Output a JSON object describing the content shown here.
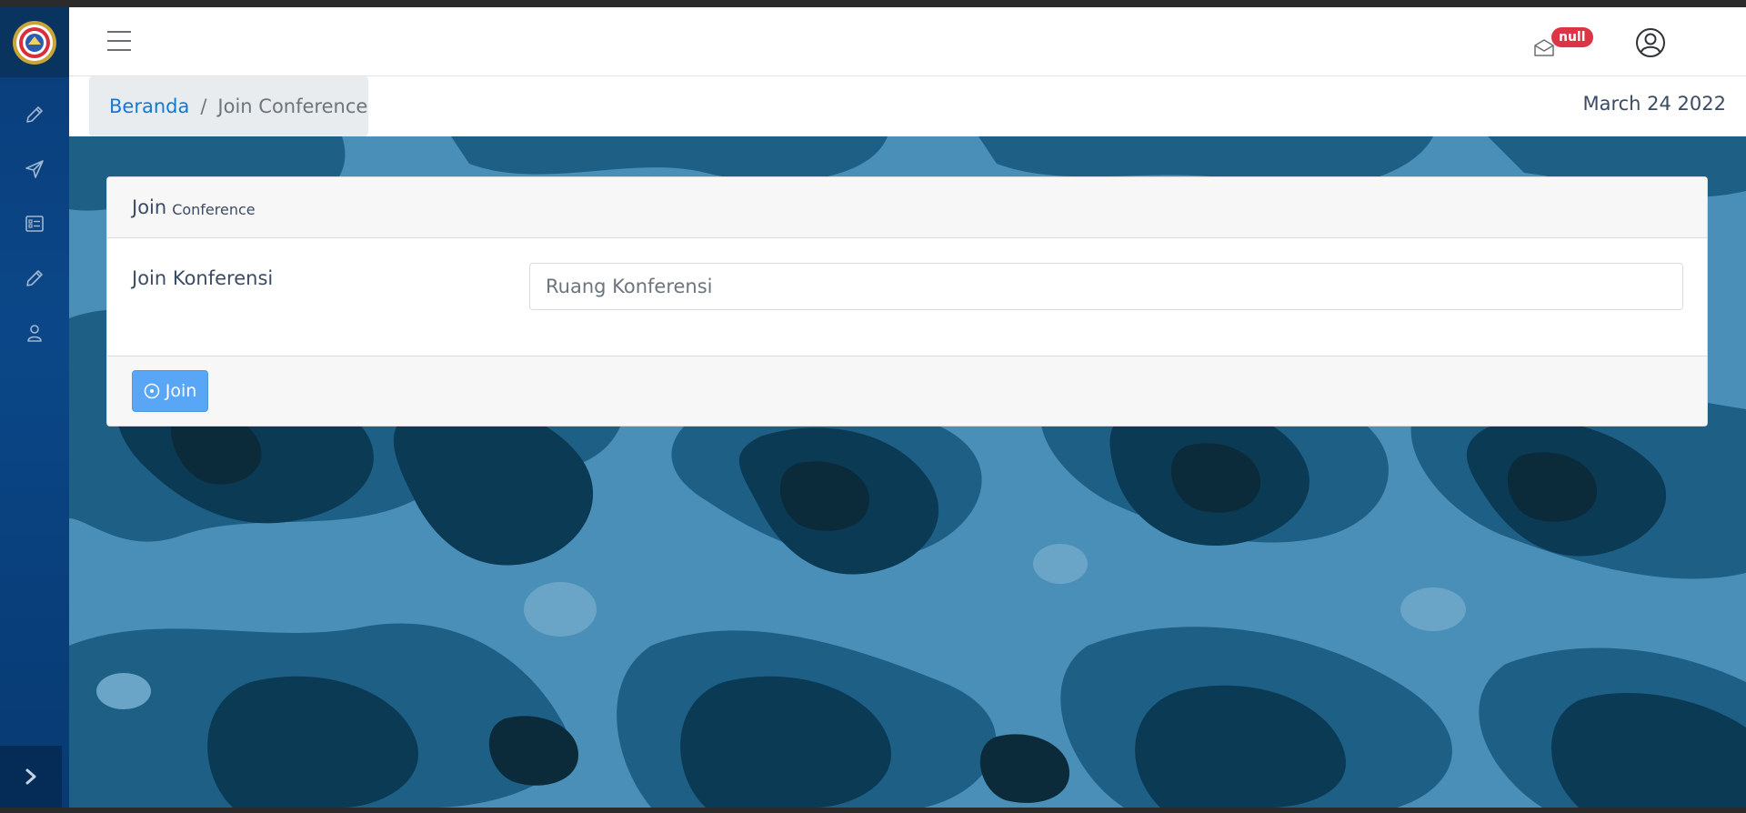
{
  "header": {
    "notification_badge": "null"
  },
  "breadcrumb": {
    "home": "Beranda",
    "separator": "/",
    "current": "Join Conference"
  },
  "date": "March 24 2022",
  "card": {
    "title": "Join",
    "subtitle": "Conference",
    "form_label": "Join Konferensi",
    "input_placeholder": "Ruang Konferensi",
    "input_value": "",
    "join_button_label": "Join"
  },
  "sidebar": {
    "items": [
      {
        "icon": "pencil-icon"
      },
      {
        "icon": "send-icon"
      },
      {
        "icon": "list-card-icon"
      },
      {
        "icon": "pencil-icon"
      },
      {
        "icon": "user-icon"
      }
    ]
  },
  "colors": {
    "sidebar": "#0b4788",
    "primary_button": "#58a6f5",
    "badge": "#dc3545",
    "link": "#1479d6",
    "camo_light": "#4a8fb8",
    "camo_mid": "#1e5f86",
    "camo_dark": "#0b3a55",
    "camo_darkest": "#0b2a3a"
  }
}
